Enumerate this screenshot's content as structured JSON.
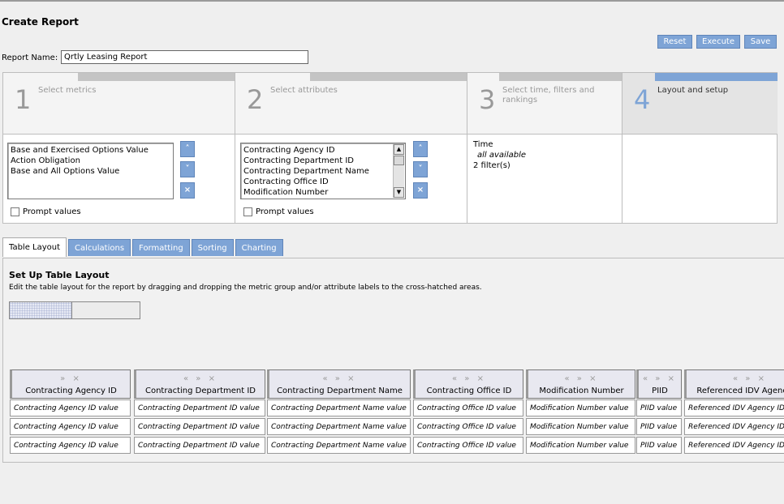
{
  "page": {
    "title": "Create Report"
  },
  "toolbar": {
    "reset_label": "Reset",
    "execute_label": "Execute",
    "save_label": "Save"
  },
  "report_name": {
    "label": "Report Name:",
    "value": "Qrtly Leasing Report"
  },
  "steps": [
    {
      "number": "1",
      "label": "Select metrics"
    },
    {
      "number": "2",
      "label": "Select attributes"
    },
    {
      "number": "3",
      "label": "Select time, filters and rankings"
    },
    {
      "number": "4",
      "label": "Layout and setup",
      "active": true
    }
  ],
  "metrics": {
    "items": [
      "Base and Exercised Options Value",
      "Action Obligation",
      "Base and All Options Value"
    ],
    "prompt_label": "Prompt values"
  },
  "attributes": {
    "items": [
      "Contracting Agency ID",
      "Contracting Department ID",
      "Contracting Department Name",
      "Contracting Office ID",
      "Modification Number"
    ],
    "prompt_label": "Prompt values"
  },
  "order_buttons": {
    "up_glyph": "˄",
    "down_glyph": "˅",
    "remove_glyph": "×"
  },
  "time_filters": {
    "time_label": "Time",
    "time_value": "all available",
    "filters": "2 filter(s)"
  },
  "tabs": [
    {
      "label": "Table Layout",
      "active": true
    },
    {
      "label": "Calculations"
    },
    {
      "label": "Formatting"
    },
    {
      "label": "Sorting"
    },
    {
      "label": "Charting"
    }
  ],
  "layout": {
    "title": "Set Up Table Layout",
    "description": "Edit the table layout for the report by dragging and dropping the metric group and/or attribute labels to the cross-hatched areas."
  },
  "table": {
    "columns": [
      {
        "header": "Contracting Agency ID",
        "controls": "» ×",
        "cell": "Contracting Agency ID value"
      },
      {
        "header": "Contracting Department ID",
        "controls": "« » ×",
        "cell": "Contracting Department ID value"
      },
      {
        "header": "Contracting Department Name",
        "controls": "« » ×",
        "cell": "Contracting Department Name value"
      },
      {
        "header": "Contracting Office ID",
        "controls": "« » ×",
        "cell": "Contracting Office ID value"
      },
      {
        "header": "Modification Number",
        "controls": "« » ×",
        "cell": "Modification Number value"
      },
      {
        "header": "PIID",
        "controls": "« » ×",
        "cell": "PIID value"
      },
      {
        "header": "Referenced IDV Agency ID",
        "controls": "« » ×",
        "cell": "Referenced IDV Agency ID value"
      }
    ]
  }
}
